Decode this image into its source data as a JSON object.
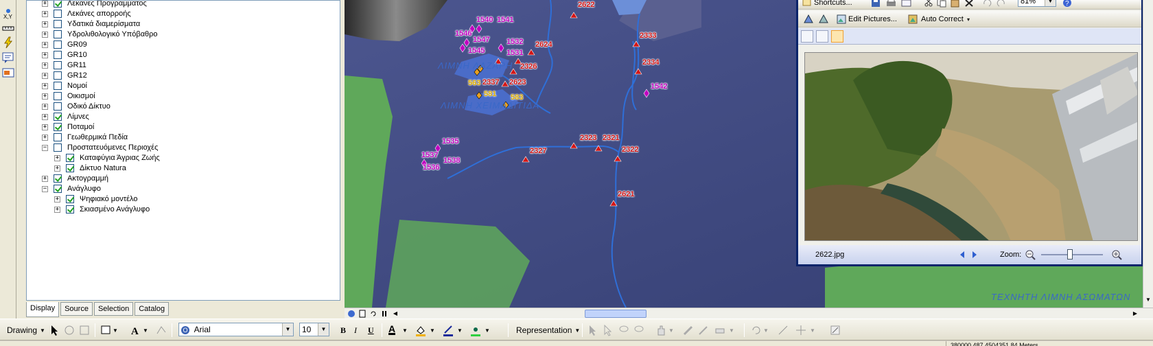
{
  "toc": {
    "layers": [
      {
        "label": "Λεκάνες Προγράμματος",
        "checked": true,
        "expander": "+",
        "level": 0
      },
      {
        "label": "Λεκάνες απορροής",
        "checked": false,
        "expander": "+",
        "level": 0
      },
      {
        "label": "Υδατικά διαμερίσματα",
        "checked": false,
        "expander": "+",
        "level": 0
      },
      {
        "label": "Υδρολιθολογικό Υπόβαθρο",
        "checked": false,
        "expander": "+",
        "level": 0
      },
      {
        "label": "GR09",
        "checked": false,
        "expander": "+",
        "level": 0
      },
      {
        "label": "GR10",
        "checked": false,
        "expander": "+",
        "level": 0
      },
      {
        "label": "GR11",
        "checked": false,
        "expander": "+",
        "level": 0
      },
      {
        "label": "GR12",
        "checked": false,
        "expander": "+",
        "level": 0
      },
      {
        "label": "Νομοί",
        "checked": false,
        "expander": "+",
        "level": 0
      },
      {
        "label": "Οικισμοί",
        "checked": false,
        "expander": "+",
        "level": 0
      },
      {
        "label": "Οδικό Δίκτυο",
        "checked": false,
        "expander": "+",
        "level": 0
      },
      {
        "label": "Λίμνες",
        "checked": true,
        "expander": "+",
        "level": 0
      },
      {
        "label": "Ποταμοί",
        "checked": true,
        "expander": "+",
        "level": 0
      },
      {
        "label": "Γεωθερμικά Πεδία",
        "checked": false,
        "expander": "+",
        "level": 0
      },
      {
        "label": "Προστατευόμενες Περιοχές",
        "checked": false,
        "expander": "−",
        "level": 0
      },
      {
        "label": "Καταφύγια Άγριας Ζωής",
        "checked": true,
        "expander": "+",
        "level": 1
      },
      {
        "label": "Δίκτυο Natura",
        "checked": true,
        "expander": "+",
        "level": 1
      },
      {
        "label": "Ακτογραμμή",
        "checked": true,
        "expander": "+",
        "level": 0
      },
      {
        "label": "Ανάγλυφο",
        "checked": true,
        "expander": "−",
        "level": 0
      },
      {
        "label": "Ψηφιακό μοντέλο",
        "checked": true,
        "expander": "+",
        "level": 1
      },
      {
        "label": "Σκιασμένο Ανάγλυφο",
        "checked": true,
        "expander": "+",
        "level": 1
      }
    ],
    "tabs": [
      "Display",
      "Source",
      "Selection",
      "Catalog"
    ]
  },
  "map": {
    "red_labels": [
      {
        "text": "2622"
      },
      {
        "text": "2624"
      },
      {
        "text": "2326"
      },
      {
        "text": "2623"
      },
      {
        "text": "2333"
      },
      {
        "text": "2334"
      },
      {
        "text": "2327"
      },
      {
        "text": "2323"
      },
      {
        "text": "2321"
      },
      {
        "text": "2322"
      },
      {
        "text": "2621"
      }
    ],
    "pink_labels": [
      {
        "text": "1540"
      },
      {
        "text": "1541"
      },
      {
        "text": "1546"
      },
      {
        "text": "1547"
      },
      {
        "text": "1532"
      },
      {
        "text": "1545"
      },
      {
        "text": "1531"
      },
      {
        "text": "1542"
      },
      {
        "text": "1535"
      },
      {
        "text": "1537"
      },
      {
        "text": "1538"
      },
      {
        "text": "1536"
      }
    ],
    "yellow_labels": [
      {
        "text": "563"
      },
      {
        "text": "2337"
      },
      {
        "text": "581"
      },
      {
        "text": "583"
      }
    ],
    "lake_labels": [
      {
        "text": "ΛΙΜΝΗ ΛΑΖΑΡΗ"
      },
      {
        "text": "ΛΙΜΝΗ ΧΕΙΜΑΔΙΤΙΔΑ"
      },
      {
        "text": "ΤΕΧΝΗΤΗ ΛΙΜΝΗ ΑΣΩΜΑΤΩΝ"
      }
    ]
  },
  "viewer": {
    "shortcuts_label": "Shortcuts...",
    "zoom_value": "81%",
    "edit_pictures_label": "Edit Pictures...",
    "auto_correct_label": "Auto Correct",
    "filename": "2622.jpg",
    "zoom_label": "Zoom:"
  },
  "drawbar": {
    "drawing_label": "Drawing",
    "font_name": "Arial",
    "font_size": "10",
    "bold": "B",
    "italic": "I",
    "underline": "U",
    "font_color_glyph": "A",
    "representation_label": "Representation"
  },
  "status": {
    "coords": "380000.487 4504351.84 Meters"
  },
  "colors": {
    "map_background": "#3e4a83",
    "vegetation": "#5fa85a",
    "river": "#2f6fd8",
    "red_marker": "#d41616",
    "pink_marker": "#c000c0",
    "yellow_marker": "#e8a020",
    "viewer_frame": "#0a246a"
  }
}
